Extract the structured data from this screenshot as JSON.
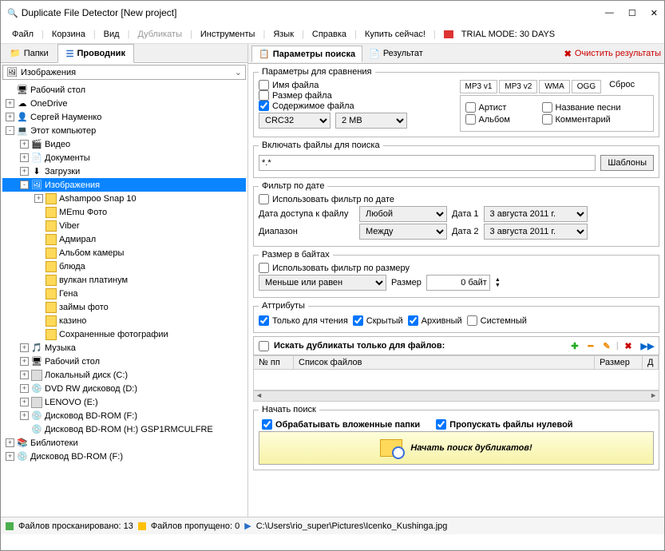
{
  "window": {
    "title": "Duplicate File Detector [New project]"
  },
  "menubar": {
    "file": "Файл",
    "trash": "Корзина",
    "view": "Вид",
    "dup": "Дубликаты",
    "tools": "Инструменты",
    "lang": "Язык",
    "help": "Справка",
    "buy": "Купить сейчас!",
    "trial": "TRIAL MODE: 30 DAYS"
  },
  "left_tabs": {
    "folders": "Папки",
    "explorer": "Проводник"
  },
  "combo_value": "Изображения",
  "tree": [
    {
      "l": 0,
      "e": "",
      "i": "🖥",
      "t": "Рабочий стол",
      "cls": ""
    },
    {
      "l": 0,
      "e": "+",
      "i": "☁",
      "t": "OneDrive",
      "cls": ""
    },
    {
      "l": 0,
      "e": "+",
      "i": "👤",
      "t": "Сергей Науменко",
      "cls": ""
    },
    {
      "l": 0,
      "e": "-",
      "i": "💻",
      "t": "Этот компьютер",
      "cls": ""
    },
    {
      "l": 1,
      "e": "+",
      "i": "🎬",
      "t": "Видео",
      "cls": ""
    },
    {
      "l": 1,
      "e": "+",
      "i": "📄",
      "t": "Документы",
      "cls": ""
    },
    {
      "l": 1,
      "e": "+",
      "i": "⬇",
      "t": "Загрузки",
      "cls": ""
    },
    {
      "l": 1,
      "e": "-",
      "i": "🖼",
      "t": "Изображения",
      "cls": "selected"
    },
    {
      "l": 2,
      "e": "+",
      "i": "f",
      "t": "Ashampoo Snap 10",
      "cls": ""
    },
    {
      "l": 2,
      "e": "",
      "i": "f",
      "t": "MEmu Фото",
      "cls": ""
    },
    {
      "l": 2,
      "e": "",
      "i": "f",
      "t": "Viber",
      "cls": ""
    },
    {
      "l": 2,
      "e": "",
      "i": "f",
      "t": "Адмирал",
      "cls": ""
    },
    {
      "l": 2,
      "e": "",
      "i": "f",
      "t": "Альбом камеры",
      "cls": ""
    },
    {
      "l": 2,
      "e": "",
      "i": "f",
      "t": "блюда",
      "cls": ""
    },
    {
      "l": 2,
      "e": "",
      "i": "f",
      "t": "вулкан платинум",
      "cls": ""
    },
    {
      "l": 2,
      "e": "",
      "i": "f",
      "t": "Гена",
      "cls": ""
    },
    {
      "l": 2,
      "e": "",
      "i": "f",
      "t": "займы фото",
      "cls": ""
    },
    {
      "l": 2,
      "e": "",
      "i": "f",
      "t": "казино",
      "cls": ""
    },
    {
      "l": 2,
      "e": "",
      "i": "f",
      "t": "Сохраненные фотографии",
      "cls": ""
    },
    {
      "l": 1,
      "e": "+",
      "i": "🎵",
      "t": "Музыка",
      "cls": ""
    },
    {
      "l": 1,
      "e": "+",
      "i": "🖥",
      "t": "Рабочий стол",
      "cls": ""
    },
    {
      "l": 1,
      "e": "+",
      "i": "d",
      "t": "Локальный диск (C:)",
      "cls": ""
    },
    {
      "l": 1,
      "e": "+",
      "i": "💿",
      "t": "DVD RW дисковод (D:)",
      "cls": ""
    },
    {
      "l": 1,
      "e": "+",
      "i": "d",
      "t": "LENOVO (E:)",
      "cls": ""
    },
    {
      "l": 1,
      "e": "+",
      "i": "💿",
      "t": "Дисковод BD-ROM (F:)",
      "cls": ""
    },
    {
      "l": 1,
      "e": "",
      "i": "💿",
      "t": "Дисковод BD-ROM (H:) GSP1RMCULFRE",
      "cls": ""
    },
    {
      "l": 0,
      "e": "+",
      "i": "📚",
      "t": "Библиотеки",
      "cls": ""
    },
    {
      "l": 0,
      "e": "+",
      "i": "💿",
      "t": "Дисковод BD-ROM (F:)",
      "cls": ""
    }
  ],
  "right_tabs": {
    "params": "Параметры поиска",
    "result": "Результат",
    "clear": "Очистить результаты"
  },
  "compare": {
    "legend": "Параметры для сравнения",
    "filename": "Имя файла",
    "filesize": "Размер файла",
    "content": "Содержимое файла",
    "method": "CRC32",
    "block": "2 MB",
    "tagtabs": [
      "MP3 v1",
      "MP3 v2",
      "WMA",
      "OGG"
    ],
    "reset": "Сброс",
    "artist": "Артист",
    "title": "Название песни",
    "album": "Альбом",
    "comment": "Комментарий"
  },
  "include": {
    "legend": "Включать файлы для поиска",
    "pattern": "*.*",
    "tpl": "Шаблоны"
  },
  "datef": {
    "legend": "Фильтр по дате",
    "use": "Использовать фильтр по дате",
    "access": "Дата доступа к файлу",
    "any": "Любой",
    "range": "Диапазон",
    "between": "Между",
    "d1": "Дата 1",
    "d2": "Дата 2",
    "date": "3 августа   2011 г."
  },
  "sizef": {
    "legend": "Размер в байтах",
    "use": "Использовать фильтр по размеру",
    "op": "Меньше или равен",
    "size_lbl": "Размер",
    "size_val": "0 байт"
  },
  "attrs": {
    "legend": "Аттрибуты",
    "ro": "Только для чтения",
    "hidden": "Скрытый",
    "arch": "Архивный",
    "sys": "Системный"
  },
  "filesonly": {
    "lbl": "Искать дубликаты только для файлов:"
  },
  "listhead": {
    "num": "№ пп",
    "files": "Список файлов",
    "size": "Размер",
    "d": "Д"
  },
  "start": {
    "legend": "Начать поиск",
    "sub": "Обрабатывать вложенные папки",
    "skip": "Пропускать файлы нулевой",
    "btn": "Начать поиск дубликатов!"
  },
  "status": {
    "scanned_lbl": "Файлов просканировано:",
    "scanned": "13",
    "skipped_lbl": "Файлов пропущено:",
    "skipped": "0",
    "path": "C:\\Users\\rio_super\\Pictures\\Icenko_Kushinga.jpg"
  }
}
